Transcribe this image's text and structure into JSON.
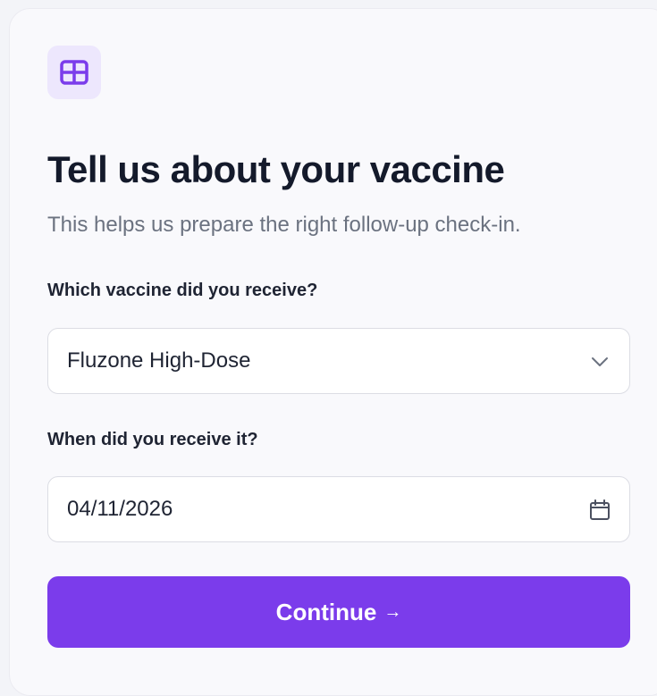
{
  "header": {
    "icon": "grid-icon",
    "title": "Tell us about your vaccine",
    "subtitle": "This helps us prepare the right follow-up check-in."
  },
  "vaccine": {
    "label": "Which vaccine did you receive?",
    "selected": "Fluzone High-Dose",
    "icon": "chevron-down-icon"
  },
  "date": {
    "label": "When did you receive it?",
    "value": "04/11/2026",
    "icon": "calendar-icon"
  },
  "actions": {
    "continue_label": "Continue",
    "continue_arrow": "→"
  },
  "colors": {
    "accent": "#7b3ceb",
    "icon_tile_bg": "#ede7fd",
    "title_text": "#141a2b",
    "muted_text": "#6b7280"
  }
}
